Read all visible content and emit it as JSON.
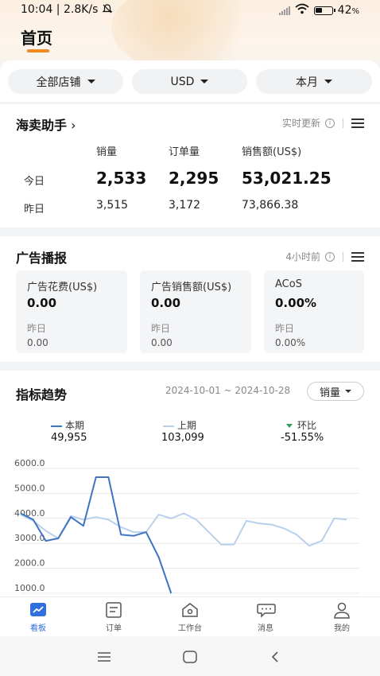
{
  "status_bar": {
    "time_speed": "10:04 | 2.8K/s",
    "battery": "42",
    "battery_unit": "%",
    "battery_level": 0.42
  },
  "page": {
    "title": "首页"
  },
  "filters": [
    "全部店铺",
    "USD",
    "本月"
  ],
  "sales_card": {
    "title": "海卖助手",
    "update_label": "实时更新",
    "columns": [
      "销量",
      "订单量",
      "销售额(US$)"
    ],
    "rows": [
      {
        "label": "今日",
        "values": [
          "2,533",
          "2,295",
          "53,021.25"
        ]
      },
      {
        "label": "昨日",
        "values": [
          "3,515",
          "3,172",
          "73,866.38"
        ]
      }
    ]
  },
  "ads_card": {
    "title": "广告播报",
    "update_label": "4小时前",
    "yesterday_label": "昨日",
    "boxes": [
      {
        "title": "广告花费(US$)",
        "value": "0.00",
        "yesterday": "0.00"
      },
      {
        "title": "广告销售额(US$)",
        "value": "0.00",
        "yesterday": "0.00"
      },
      {
        "title": "ACoS",
        "value": "0.00%",
        "yesterday": "0.00%"
      }
    ]
  },
  "trend_card": {
    "title": "指标趋势",
    "date_range": "2024-10-01 ~ 2024-10-28",
    "metric": "销量",
    "legend": [
      {
        "label": "本期",
        "value": "49,955",
        "color": "#3f74c4"
      },
      {
        "label": "上期",
        "value": "103,099",
        "color": "#b9d0ec"
      },
      {
        "label": "环比",
        "value": "-51.55%",
        "color": "#2e9b5a"
      }
    ]
  },
  "chart_data": {
    "type": "line",
    "y_ticks": [
      "6000.0",
      "5000.0",
      "4000.0",
      "3000.0",
      "2000.0",
      "1000.0"
    ],
    "ylim": [
      1000,
      6000
    ],
    "x": [
      1,
      2,
      3,
      4,
      5,
      6,
      7,
      8,
      9,
      10,
      11,
      12,
      13,
      14,
      15,
      16,
      17,
      18,
      19,
      20,
      21,
      22,
      23,
      24,
      25,
      26,
      27,
      28
    ],
    "series": [
      {
        "name": "本期",
        "color": "#3f74c4",
        "values": [
          4200,
          3950,
          3100,
          3200,
          4050,
          3700,
          5650,
          5650,
          3350,
          3300,
          3450,
          2450,
          1000
        ]
      },
      {
        "name": "上期",
        "color": "#b9d0ec",
        "values": [
          4150,
          3900,
          3500,
          3200,
          4100,
          3950,
          4050,
          3950,
          3650,
          3450,
          3450,
          4150,
          4000,
          4200,
          3950,
          3450,
          2950,
          2950,
          3900,
          3800,
          3750,
          3600,
          3350,
          2900,
          3100,
          4000,
          3950
        ]
      }
    ]
  },
  "tabbar": {
    "items": [
      {
        "label": "看板",
        "icon": "chart-icon",
        "active": true
      },
      {
        "label": "订单",
        "icon": "order-icon",
        "active": false
      },
      {
        "label": "工作台",
        "icon": "home-icon",
        "active": false
      },
      {
        "label": "消息",
        "icon": "message-icon",
        "active": false
      },
      {
        "label": "我的",
        "icon": "user-icon",
        "active": false
      }
    ]
  },
  "colors": {
    "accent": "#f08a24",
    "primary": "#2f6fde"
  }
}
